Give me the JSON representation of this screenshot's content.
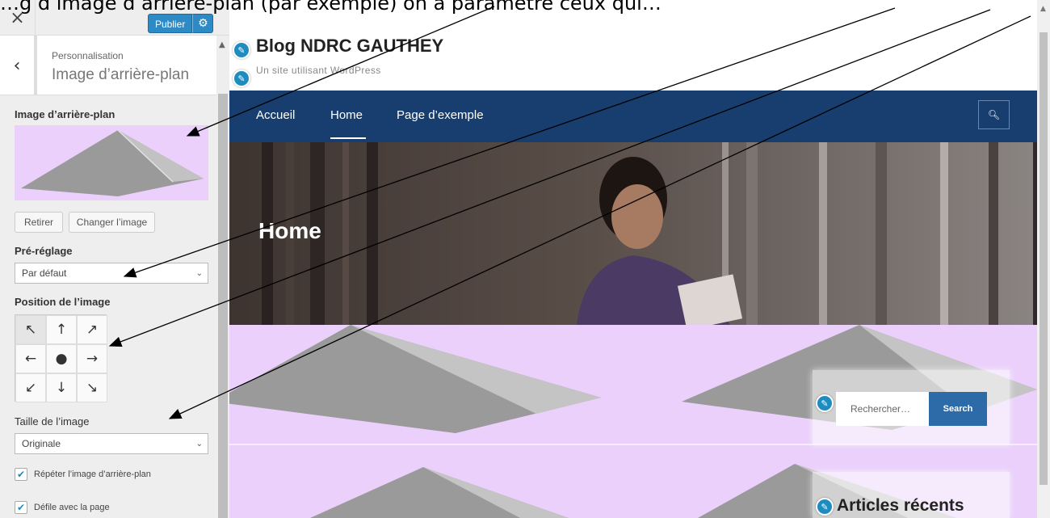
{
  "panel": {
    "close_glyph": "×",
    "publish_label": "Publier",
    "breadcrumb": "Personnalisation",
    "section_title": "Image d’arrière-plan",
    "back_glyph": "‹",
    "image_label": "Image d’arrière-plan",
    "remove_label": "Retirer",
    "change_label": "Changer l’image",
    "preset_label": "Pré-réglage",
    "preset_value": "Par défaut",
    "position_label": "Position de l’image",
    "position_grid": [
      "↖",
      "↑",
      "↗",
      "←",
      "●",
      "→",
      "↙",
      "↓",
      "↘"
    ],
    "size_label": "Taille de l’image",
    "size_value": "Originale",
    "repeat_label": "Répéter l’image d’arrière-plan",
    "scroll_label": "Défile avec la page"
  },
  "site": {
    "title": "Blog NDRC GAUTHEY",
    "tagline": "Un site utilisant WordPress",
    "nav": [
      "Accueil",
      "Home",
      "Page d’exemple"
    ],
    "nav_active": "Home",
    "hero_title": "Home",
    "search_placeholder": "Rechercher…",
    "search_button": "Search",
    "recent_posts_title": "Articles récents"
  },
  "caption_text": "…g d’image d’arrière-plan (par exemple) on a paramétré ceux qui…",
  "colors": {
    "nav_bg": "#173e6e",
    "accent_blue": "#1e8cbe",
    "background_pink": "#ead0fb",
    "publish_blue": "#2e8ac5"
  }
}
